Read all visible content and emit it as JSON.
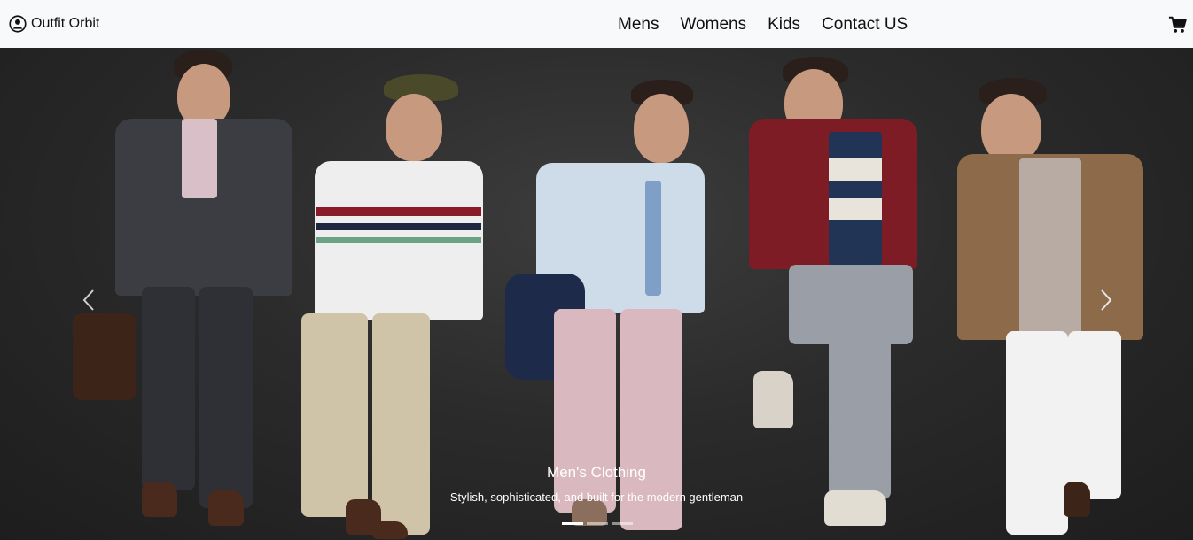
{
  "brand": {
    "name": "Outfit Orbit",
    "icon": "user-circle-icon"
  },
  "nav": {
    "items": [
      {
        "label": "Mens"
      },
      {
        "label": "Womens"
      },
      {
        "label": "Kids"
      },
      {
        "label": "Contact US"
      }
    ]
  },
  "cart": {
    "icon": "cart-icon"
  },
  "carousel": {
    "caption_title": "Men's Clothing",
    "caption_text": "Stylish, sophisticated, and built for the modern gentleman",
    "prev_icon": "chevron-left-icon",
    "next_icon": "chevron-right-icon",
    "indicator_count": 3,
    "active_indicator": 1
  },
  "colors": {
    "navbar_bg": "#f8f9fa",
    "hero_bg": "#2b2b2b",
    "caption_text": "#ffffff"
  }
}
